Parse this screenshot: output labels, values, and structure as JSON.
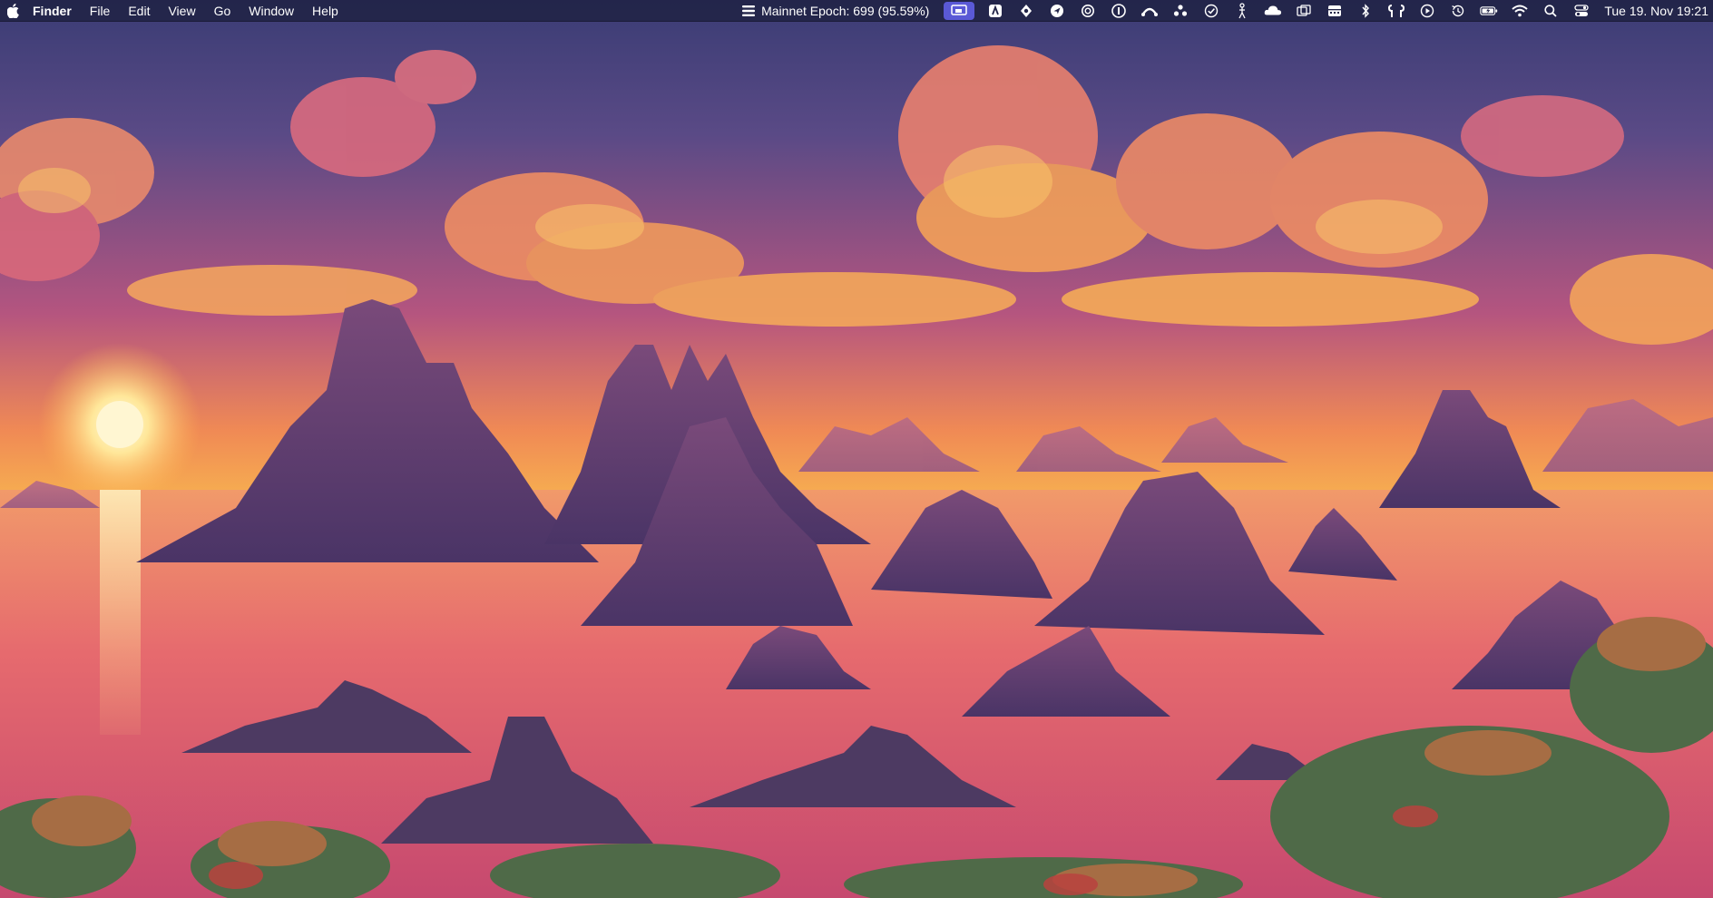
{
  "menubar": {
    "app_name": "Finder",
    "menus": [
      "File",
      "Edit",
      "View",
      "Go",
      "Window",
      "Help"
    ],
    "status_text": "Mainnet Epoch: 699 (95.59%)",
    "clock": "Tue 19. Nov  19:21",
    "status_icons": [
      "screen-mirroring-icon",
      "notes-app-icon",
      "shield-app-icon",
      "navigation-app-icon",
      "chatgpt-icon",
      "onepassword-icon",
      "headphones-arc-icon",
      "dots-cluster-icon",
      "checkmark-circle-icon",
      "accessibility-icon",
      "cloud-icon",
      "copy-windows-icon",
      "calendar-icon",
      "bluetooth-icon",
      "airpods-icon",
      "play-circle-icon",
      "time-machine-icon",
      "battery-icon",
      "wifi-icon",
      "search-icon",
      "control-center-icon"
    ]
  },
  "colors": {
    "menubar": "#222448",
    "active_icon": "#5a59d6",
    "sky_top": "#3d3f78",
    "sky_mid": "#c9567a",
    "horizon": "#f6a94a",
    "water": "#e7616a",
    "mountains": "#5b3a6e"
  },
  "desktop": {
    "wallpaper": "sunset-island-landscape"
  }
}
